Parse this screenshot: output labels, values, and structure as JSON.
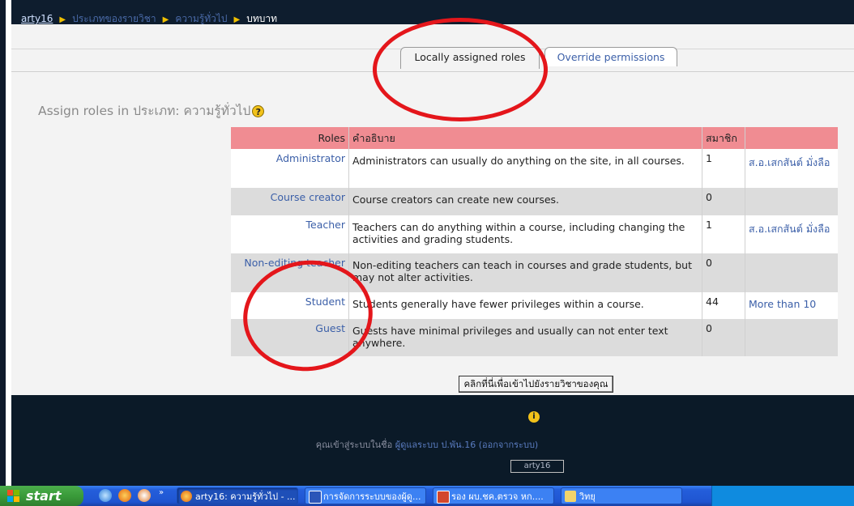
{
  "breadcrumb": {
    "home": "arty16",
    "level1": "ประเภทของรายวิชา",
    "level2": "ความรู้ทั่วไป",
    "current": "บทบาท"
  },
  "tabs": [
    {
      "label": "Locally assigned roles",
      "active": true
    },
    {
      "label": "Override permissions",
      "active": false
    }
  ],
  "heading": "Assign roles in ประเภท: ความรู้ทั่วไป",
  "table": {
    "headers": {
      "roles": "Roles",
      "description": "คำอธิบาย",
      "members": "สมาชิก",
      "users": ""
    },
    "rows": [
      {
        "role": "Administrator",
        "description": "Administrators can usually do anything on the site, in all courses.",
        "members": "1",
        "users": "ส.อ.เสกสันต์ มั่งลือ"
      },
      {
        "role": "Course creator",
        "description": "Course creators can create new courses.",
        "members": "0",
        "users": ""
      },
      {
        "role": "Teacher",
        "description": "Teachers can do anything within a course, including changing the activities and grading students.",
        "members": "1",
        "users": "ส.อ.เสกสันต์ มั่งลือ"
      },
      {
        "role": "Non-editing teacher",
        "description": "Non-editing teachers can teach in courses and grade students, but may not alter activities.",
        "members": "0",
        "users": ""
      },
      {
        "role": "Student",
        "description": "Students generally have fewer privileges within a course.",
        "members": "44",
        "users": "More than 10"
      },
      {
        "role": "Guest",
        "description": "Guests have minimal privileges and usually can not enter text anywhere.",
        "members": "0",
        "users": ""
      }
    ]
  },
  "go_button": "คลิกที่นี่เพื่อเข้าไปยังรายวิชาของคุณ",
  "footer": {
    "login_prefix": "คุณเข้าสู่ระบบในชื่อ",
    "login_user": "ผู้ดูแลระบบ ป.พัน.16",
    "logout": "(ออกจากระบบ)",
    "site": "arty16"
  },
  "taskbar": {
    "start": "start",
    "tasks": [
      "arty16: ความรู้ทั่วไป - ...",
      "การจัดการระบบของผู้ดู...",
      "รอง ผบ.ชค.ตรวจ หก....",
      "วิทยุ"
    ]
  },
  "colors": {
    "header_row": "#f08c92",
    "link": "#3b5fa8",
    "annotation": "#e4161b"
  }
}
